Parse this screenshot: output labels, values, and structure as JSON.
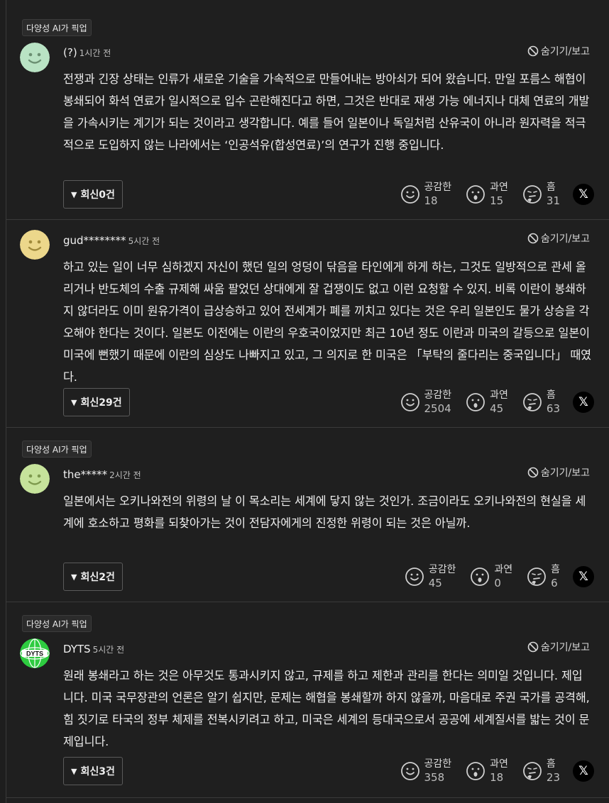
{
  "labels": {
    "ai_pick": "다양성 AI가 픽업",
    "hide_report": "숨기기/보고",
    "react_like": "공감한",
    "react_indeed": "과연",
    "react_hmm": "흠",
    "share": "𝕏"
  },
  "comments": [
    {
      "user": "(?)",
      "time": "1시간 전",
      "text": "전쟁과 긴장 상태는 인류가 새로운 기술을 가속적으로 만들어내는 방아쇠가 되어 왔습니다. 만일 포름스 해협이 봉쇄되어 화석 연료가 일시적으로 입수 곤란해진다고 하면, 그것은 반대로 재생 가능 에너지나 대체 연료의 개발을 가속시키는 계기가 되는 것이라고 생각합니다. 예를 들어 일본이나 독일처럼 산유국이 아니라 원자력을 적극적으로 도입하지 않는 나라에서는 ‘인공석유(합성연료)’의 연구가 진행 중입니다.",
      "reply": "회신0건",
      "like": "18",
      "indeed": "15",
      "hmm": "31",
      "avatar_color": "#b9e3c4"
    },
    {
      "user": "gud********",
      "time": "5시간 전",
      "text": "하고 있는 일이 너무 심하겠지 자신이 했던 일의 엉덩이 닦음을 타인에게 하게 하는, 그것도 일방적으로 관세 올리거나 반도체의 수출 규제해 싸움 팔었던 상대에게 잘 겁쟁이도 없고 이런 요청할 수 있지. 비록 이란이 봉쇄하지 않더라도 이미 원유가격이 급상승하고 있어 전세계가 폐를 끼치고 있다는 것은 우리 일본인도 물가 상승을 각오해야 한다는 것이다. 일본도 이전에는 이란의 우호국이었지만 최근 10년 정도 이란과 미국의 갈등으로 일본이 미국에 뻔했기 때문에 이란의 심상도 나빠지고 있고, 그 의지로 한 미국은 「부탁의 줄다리는 중국입니다」 때였다.",
      "reply": "회신29건",
      "like": "2504",
      "indeed": "45",
      "hmm": "63",
      "avatar_color": "#ecd78b"
    },
    {
      "user": "the*****",
      "time": "2시간 전",
      "text": "일본에서는 오키나와전의 위령의 날 이 목소리는 세계에 닿지 않는 것인가. 조금이라도 오키나와전의 현실을 세계에 호소하고 평화를 되찾아가는 것이 전담자에게의 진정한 위령이 되는 것은 아닐까.",
      "reply": "회신2건",
      "like": "45",
      "indeed": "0",
      "hmm": "6",
      "avatar_color": "#c6e39b"
    },
    {
      "user": "DYTS",
      "time": "5시간 전",
      "text": "원래 봉쇄라고 하는 것은 아무것도 통과시키지 않고, 규제를 하고 제한과 관리를 한다는 의미일 것입니다. 제입니다. 미국 국무장관의 언론은 알기 쉽지만, 문제는 해협을 봉쇄할까 하지 않을까, 마음대로 주권 국가를 공격해, 힘 짓기로 타국의 정부 체제를 전복시키려고 하고, 미국은 세계의 등대국으로서 공공에 세계질서를 밟는 것이 문제입니다.",
      "reply": "회신3건",
      "like": "358",
      "indeed": "18",
      "hmm": "23",
      "avatar_color": "#2ecc40",
      "avatar_text": "DYTS"
    }
  ]
}
